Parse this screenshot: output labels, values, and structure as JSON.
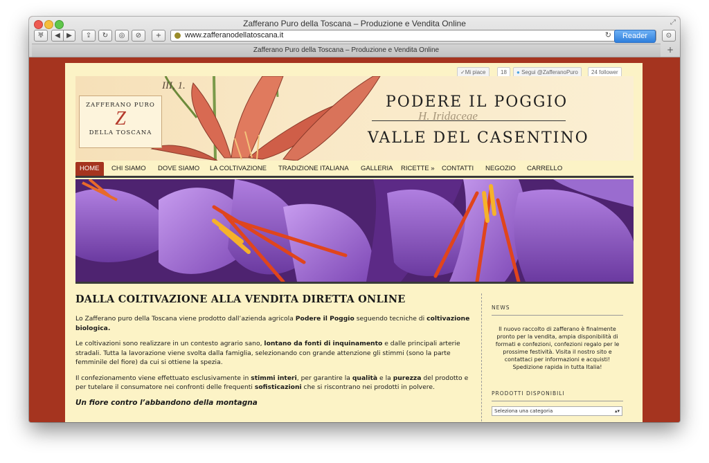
{
  "window": {
    "title": "Zafferano Puro della Toscana – Produzione e Vendita Online",
    "url": "www.zafferanodellatoscana.it",
    "reader_label": "Reader",
    "tab_title": "Zafferano Puro della Toscana – Produzione e Vendita Online",
    "toolbar": {
      "reading_list": "♅",
      "back": "◀",
      "forward": "▶",
      "share": "⇪",
      "reload_btn": "↻",
      "history": "◎",
      "bookmarks": "⊘",
      "add": "+",
      "reload_url": "↻",
      "downloads": "⊙",
      "new_tab": "+",
      "fullscreen": "⤢"
    }
  },
  "social": {
    "like_label": "✓Mi piace",
    "like_count": "18",
    "follow_label": "Segui @ZafferanoPuro",
    "followers": "24 follower"
  },
  "banner": {
    "logo_top": "ZAFFERANO PURO",
    "logo_mark": "Z",
    "logo_bottom": "DELLA TOSCANA",
    "title1": "PODERE IL POGGIO",
    "subtitle_script": "H. Iridaceae",
    "title2": "VALLE DEL CASENTINO",
    "script_corner": "III, 1."
  },
  "nav": {
    "items": [
      "HOME",
      "CHI SIAMO",
      "DOVE SIAMO",
      "LA COLTIVAZIONE",
      "TRADIZIONE ITALIANA",
      "GALLERIA",
      "RICETTE »",
      "CONTATTI",
      "NEGOZIO",
      "CARRELLO"
    ]
  },
  "article": {
    "title": "DALLA COLTIVAZIONE ALLA VENDITA DIRETTA ONLINE",
    "p1": [
      "Lo Zafferano puro della Toscana viene prodotto dall’azienda agricola ",
      "Podere il Poggio",
      " seguendo tecniche di ",
      "coltivazione biologica."
    ],
    "p2": [
      "Le coltivazioni sono realizzare in un contesto agrario sano, ",
      "lontano da fonti di inquinamento",
      " e dalle principali arterie stradali. Tutta la lavorazione viene svolta dalla famiglia, selezionando con grande attenzione gli stimmi (sono la parte femminile del fiore) da cui si ottiene la spezia."
    ],
    "p3": [
      "Il confezionamento viene effettuato esclusivamente in ",
      "stimmi interi",
      ", per garantire la ",
      "qualità",
      " e la ",
      "purezza",
      " del prodotto e per tutelare il consumatore nei confronti delle frequenti ",
      "sofisticazioni",
      " che si riscontrano nei prodotti in polvere."
    ],
    "h2": "Un fiore contro l’abbandono della montagna"
  },
  "sidebar": {
    "news_heading": "NEWS",
    "news_text": "Il nuovo raccolto di zafferano è finalmente pronto per la vendita, ampia disponibilità di formati e confezioni, confezioni regalo per le prossime festività. Visita il nostro sito e contattaci per informazioni e acquisti! Spedizione rapida in tutta Italia!",
    "products_heading": "PRODOTTI DISPONIBILI",
    "select_placeholder": "Seleziona una categoria"
  },
  "colors": {
    "brand_red": "#a5341f",
    "page_bg": "#fcf3c6",
    "reader_blue": "#2f7fdc"
  }
}
